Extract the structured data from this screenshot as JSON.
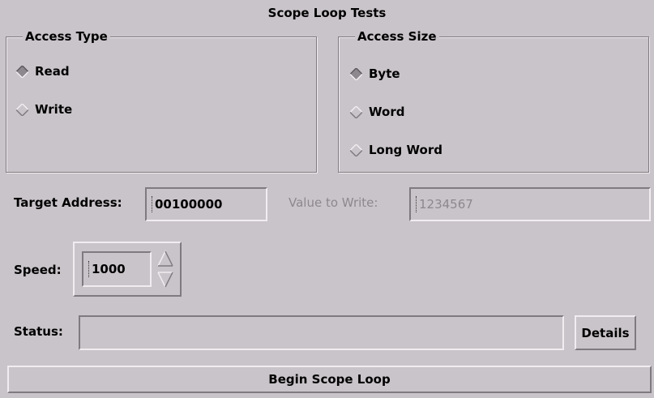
{
  "window": {
    "title": "Scope Loop Tests"
  },
  "access_type": {
    "legend": "Access Type",
    "options": [
      {
        "label": "Read",
        "selected": true
      },
      {
        "label": "Write",
        "selected": false
      }
    ]
  },
  "access_size": {
    "legend": "Access Size",
    "options": [
      {
        "label": "Byte",
        "selected": true
      },
      {
        "label": "Word",
        "selected": false
      },
      {
        "label": "Long Word",
        "selected": false
      }
    ]
  },
  "target_address": {
    "label": "Target Address:",
    "value": "00100000"
  },
  "value_to_write": {
    "label": "Value to Write:",
    "value": "1234567",
    "enabled": false
  },
  "speed": {
    "label": "Speed:",
    "value": "1000"
  },
  "status": {
    "label": "Status:",
    "value": "",
    "details_label": "Details",
    "details_enabled": false
  },
  "begin_button": {
    "label": "Begin Scope Loop"
  },
  "colors": {
    "background": "#c9c4c9",
    "shadow": "#7f7a7f",
    "highlight": "#f0ecf0",
    "disabled_text": "#8d888d"
  }
}
